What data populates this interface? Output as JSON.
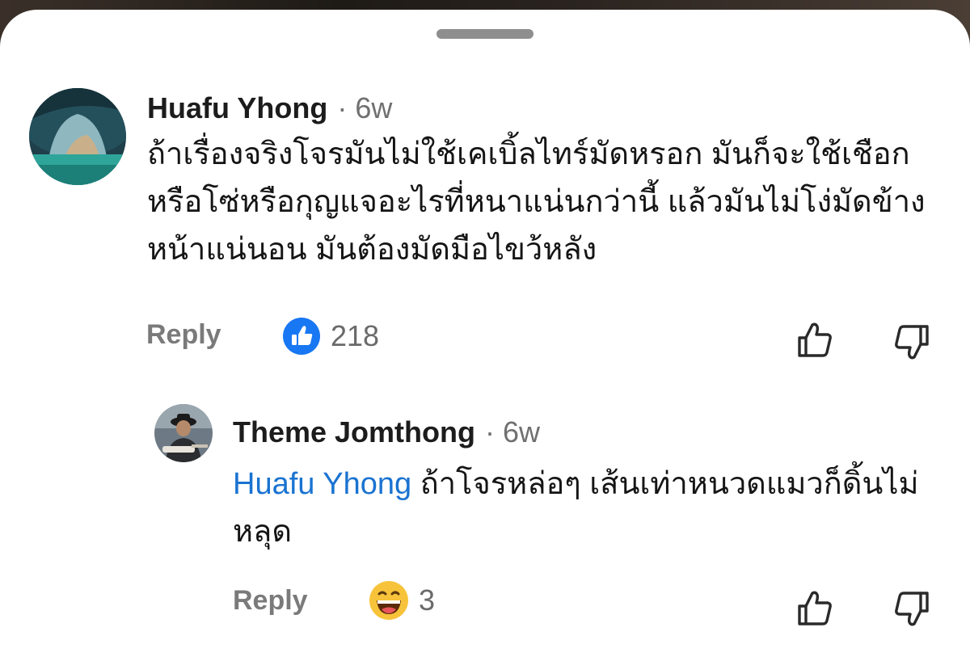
{
  "comments": [
    {
      "author": "Huafu Yhong",
      "separator": "·",
      "time": "6w",
      "text": "ถ้าเรื่องจริงโจรมันไม่ใช้เคเบิ้ลไทร์มัดหรอก มันก็จะใช้เชือกหรือโซ่หรือกุญแจอะไรที่หนาแน่นกว่านี้ แล้วมันไม่โง่มัดข้างหน้าแน่นอน มันต้องมัดมือไขว้หลัง",
      "reply_label": "Reply",
      "reaction": {
        "icon": "like-reaction-icon",
        "count": "218"
      }
    },
    {
      "author": "Theme Jomthong",
      "separator": "·",
      "time": "6w",
      "mention": "Huafu Yhong",
      "text": " ถ้าโจรหล่อๆ เส้นเท่าหนวดแมวก็ดิ้นไม่หลุด",
      "reply_label": "Reply",
      "reaction": {
        "icon": "haha-reaction-icon",
        "count": "3"
      }
    }
  ],
  "colors": {
    "mention": "#1a73d1",
    "like_blue": "#1877f2",
    "haha_yellow": "#f7c33b"
  }
}
